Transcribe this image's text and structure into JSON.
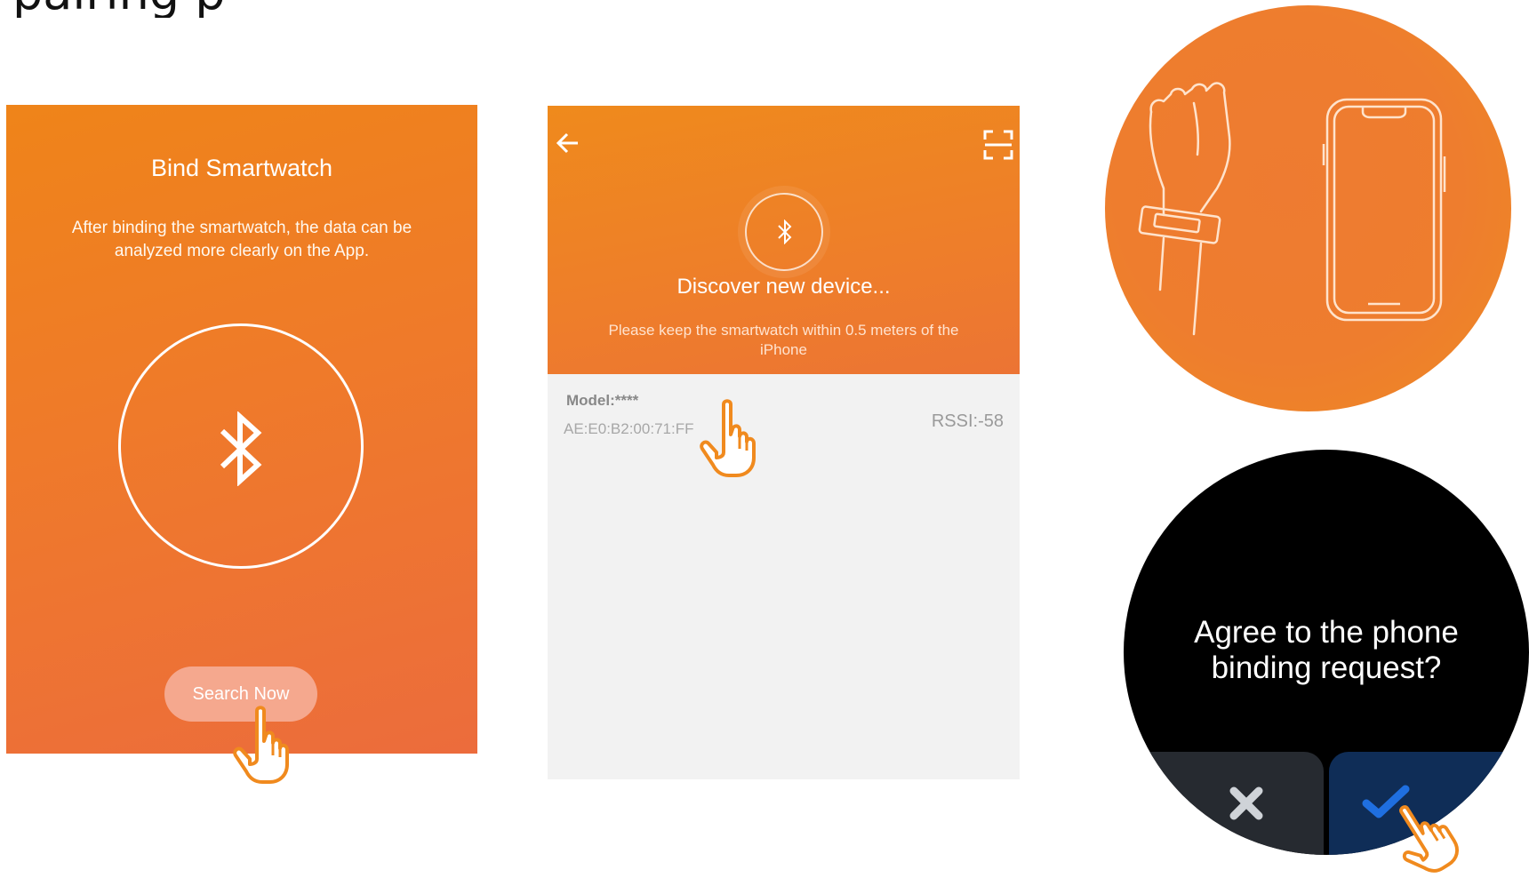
{
  "top_text": "pairing p",
  "panel1": {
    "title": "Bind Smartwatch",
    "description": "After binding the smartwatch, the data can be analyzed more clearly on the App.",
    "search_button": "Search Now"
  },
  "panel2": {
    "discover_title": "Discover new device...",
    "keep_text": "Please keep the smartwatch within 0.5 meters of the iPhone",
    "device": {
      "model": "Model:****",
      "mac": "AE:E0:B2:00:71:FF",
      "rssi": "RSSI:-58"
    }
  },
  "watch": {
    "question": "Agree to the phone binding request?"
  },
  "colors": {
    "orange": "#ef7d2c",
    "accept_blue": "#1f6fe0",
    "hand_outline": "#f08a1e"
  }
}
